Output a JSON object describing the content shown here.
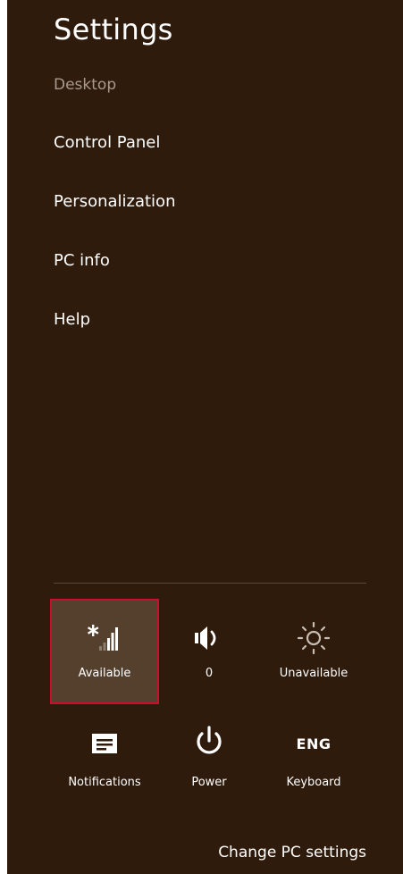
{
  "settings": {
    "title": "Settings",
    "context": "Desktop"
  },
  "menu": {
    "items": [
      {
        "label": "Control Panel"
      },
      {
        "label": "Personalization"
      },
      {
        "label": "PC info"
      },
      {
        "label": "Help"
      }
    ]
  },
  "quick_settings": {
    "network": {
      "label": "Available",
      "icon": "network-signal-icon"
    },
    "volume": {
      "label": "0",
      "icon": "speaker-icon"
    },
    "brightness": {
      "label": "Unavailable",
      "icon": "brightness-icon"
    },
    "notifications": {
      "label": "Notifications",
      "icon": "notifications-icon"
    },
    "power": {
      "label": "Power",
      "icon": "power-icon"
    },
    "keyboard": {
      "label": "Keyboard",
      "icon_text": "ENG"
    }
  },
  "footer": {
    "change_pc_settings": "Change PC settings"
  },
  "colors": {
    "panel_bg": "#2f1b0c",
    "selected_tile_bg": "#55402d",
    "selection_outline": "#c8102e",
    "muted_text": "#a89a8d"
  }
}
